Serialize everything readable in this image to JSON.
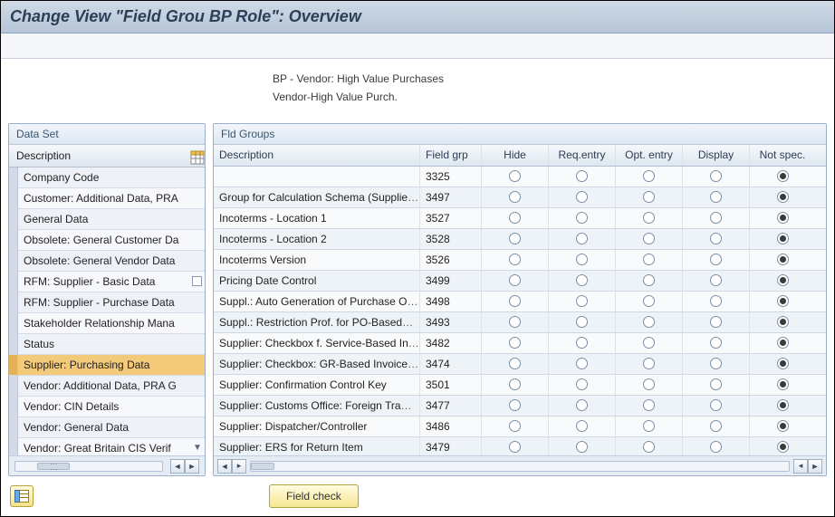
{
  "title": "Change View \"Field Grou BP Role\": Overview",
  "header": {
    "line1": "BP - Vendor: High Value Purchases",
    "line2": "Vendor-High Value Purch."
  },
  "dataset": {
    "panel_label": "Data Set",
    "col_label": "Description",
    "items": [
      {
        "label": "Company Code"
      },
      {
        "label": "Customer: Additional Data, PRA"
      },
      {
        "label": "General Data"
      },
      {
        "label": "Obsolete: General Customer Da"
      },
      {
        "label": "Obsolete: General Vendor Data"
      },
      {
        "label": "RFM: Supplier - Basic Data",
        "checkbox": true
      },
      {
        "label": "RFM: Supplier - Purchase Data"
      },
      {
        "label": "Stakeholder Relationship Mana"
      },
      {
        "label": "Status"
      },
      {
        "label": "Supplier: Purchasing Data",
        "selected": true
      },
      {
        "label": "Vendor: Additional Data, PRA G"
      },
      {
        "label": "Vendor: CIN Details"
      },
      {
        "label": "Vendor: General Data"
      },
      {
        "label": "Vendor: Great Britain CIS Verif",
        "more_indicator": true
      }
    ]
  },
  "grid": {
    "panel_label": "Fld Groups",
    "columns": {
      "description": "Description",
      "fieldgrp": "Field grp",
      "hide": "Hide",
      "req": "Req.entry",
      "opt": "Opt. entry",
      "display": "Display",
      "notspec": "Not spec."
    },
    "rows": [
      {
        "desc": "",
        "grp": "3325",
        "sel": "notspec"
      },
      {
        "desc": "Group for Calculation Schema (Supplie",
        "truncated": true,
        "grp": "3497",
        "sel": "notspec"
      },
      {
        "desc": "Incoterms - Location 1",
        "grp": "3527",
        "sel": "notspec"
      },
      {
        "desc": "Incoterms - Location 2",
        "grp": "3528",
        "sel": "notspec"
      },
      {
        "desc": "Incoterms Version",
        "grp": "3526",
        "sel": "notspec"
      },
      {
        "desc": "Pricing Date Control",
        "grp": "3499",
        "sel": "notspec"
      },
      {
        "desc": "Suppl.: Auto Generation of Purchase O",
        "truncated": true,
        "grp": "3498",
        "sel": "notspec"
      },
      {
        "desc": "Suppl.: Restriction Prof. for PO-Based ",
        "truncated": true,
        "grp": "3493",
        "sel": "notspec"
      },
      {
        "desc": "Supplier: Checkbox f. Service-Based In",
        "truncated": true,
        "grp": "3482",
        "sel": "notspec"
      },
      {
        "desc": "Supplier: Checkbox: GR-Based Invoice ",
        "truncated": true,
        "grp": "3474",
        "sel": "notspec"
      },
      {
        "desc": "Supplier: Confirmation Control Key",
        "grp": "3501",
        "sel": "notspec"
      },
      {
        "desc": "Supplier: Customs Office: Foreign Tra",
        "truncated": true,
        "grp": "3477",
        "sel": "notspec"
      },
      {
        "desc": "Supplier: Dispatcher/Controller",
        "grp": "3486",
        "sel": "notspec"
      },
      {
        "desc": "Supplier: ERS for Return Item",
        "grp": "3479",
        "sel": "notspec"
      }
    ]
  },
  "footer": {
    "field_check_label": "Field check"
  }
}
